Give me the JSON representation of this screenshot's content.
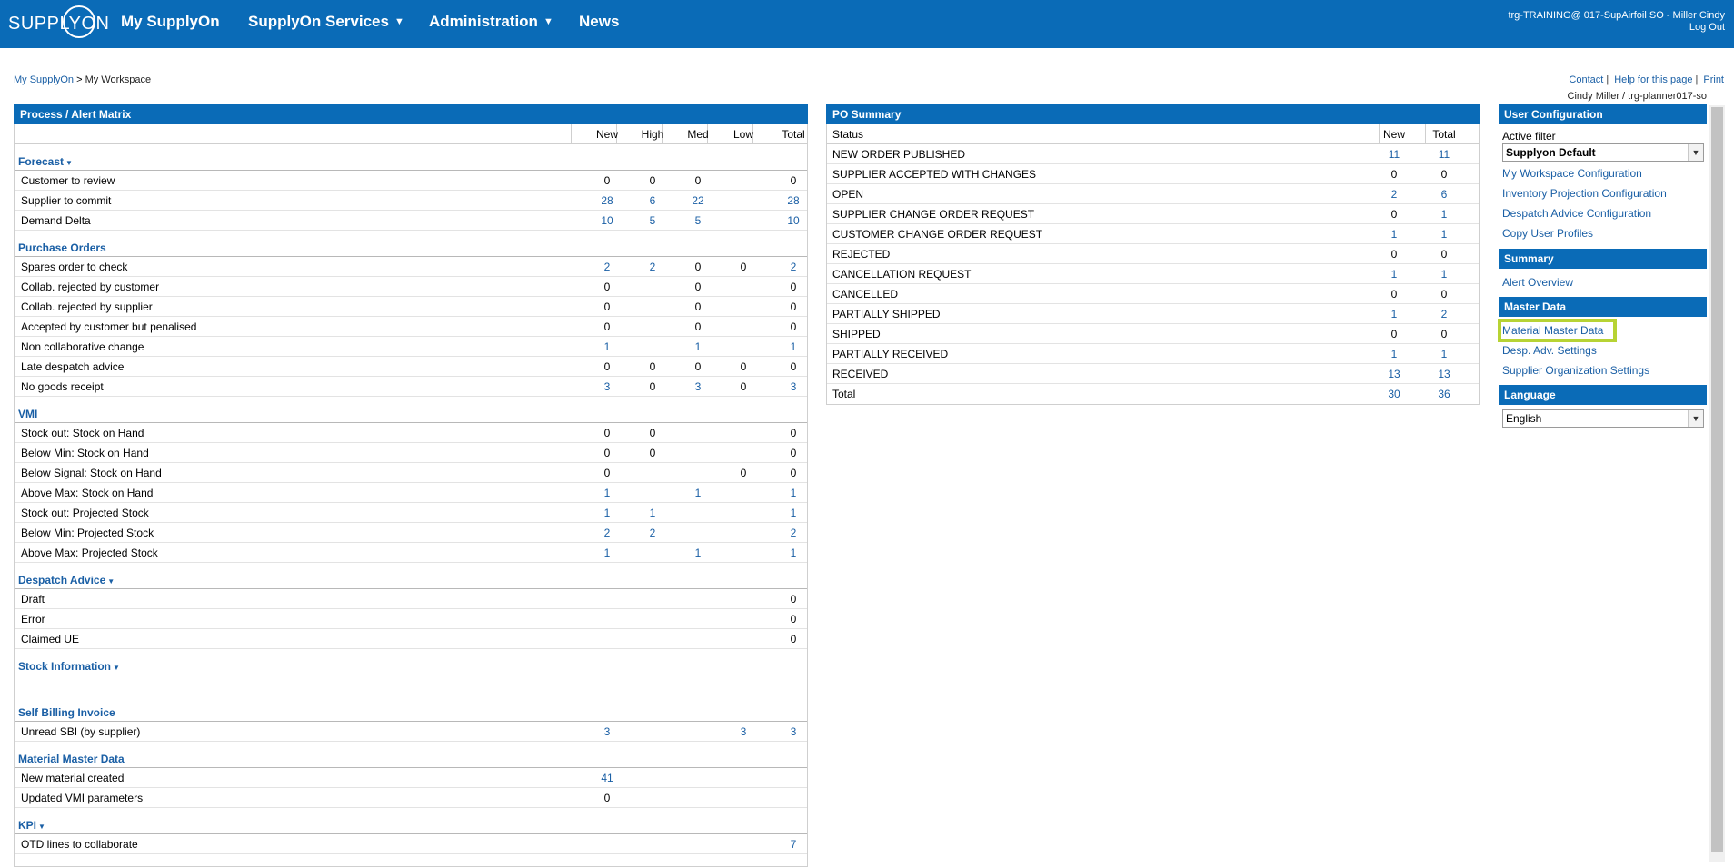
{
  "topbar": {
    "logo": "SUPPLYON",
    "nav": [
      {
        "label": "My SupplyOn",
        "caret": false
      },
      {
        "label": "SupplyOn Services",
        "caret": true
      },
      {
        "label": "Administration",
        "caret": true
      },
      {
        "label": "News",
        "caret": false
      }
    ],
    "user": "trg-TRAINING@ 017-SupAirfoil SO - Miller Cindy",
    "logout": "Log Out"
  },
  "breadcrumb": {
    "parent": "My SupplyOn",
    "sep": " > ",
    "current": "My Workspace"
  },
  "util": {
    "contact": "Contact",
    "help": "Help for this page",
    "print": "Print",
    "sep": "|"
  },
  "userline": "Cindy Miller / trg-planner017-so",
  "matrix": {
    "title": "Process / Alert Matrix",
    "columns": [
      "New",
      "High",
      "Med",
      "Low",
      "Total"
    ],
    "sections": [
      {
        "name": "Forecast",
        "dropdown": true,
        "rows": [
          {
            "label": "Customer to review",
            "v": [
              "0",
              "0",
              "0",
              "",
              "0"
            ]
          },
          {
            "label": "Supplier to commit",
            "v": [
              "28",
              "6",
              "22",
              "",
              "28"
            ]
          },
          {
            "label": "Demand Delta",
            "v": [
              "10",
              "5",
              "5",
              "",
              "10"
            ]
          }
        ]
      },
      {
        "name": "Purchase Orders",
        "dropdown": false,
        "rows": [
          {
            "label": "Spares order to check",
            "v": [
              "2",
              "2",
              "0",
              "0",
              "2"
            ]
          },
          {
            "label": "Collab. rejected by customer",
            "v": [
              "0",
              "",
              "0",
              "",
              "0"
            ]
          },
          {
            "label": "Collab. rejected by supplier",
            "v": [
              "0",
              "",
              "0",
              "",
              "0"
            ]
          },
          {
            "label": "Accepted by customer but penalised",
            "v": [
              "0",
              "",
              "0",
              "",
              "0"
            ]
          },
          {
            "label": "Non collaborative change",
            "v": [
              "1",
              "",
              "1",
              "",
              "1"
            ]
          },
          {
            "label": "Late despatch advice",
            "v": [
              "0",
              "0",
              "0",
              "0",
              "0"
            ]
          },
          {
            "label": "No goods receipt",
            "v": [
              "3",
              "0",
              "3",
              "0",
              "3"
            ]
          }
        ]
      },
      {
        "name": "VMI",
        "dropdown": false,
        "rows": [
          {
            "label": "Stock out: Stock on Hand",
            "v": [
              "0",
              "0",
              "",
              "",
              "0"
            ]
          },
          {
            "label": "Below Min: Stock on Hand",
            "v": [
              "0",
              "0",
              "",
              "",
              "0"
            ]
          },
          {
            "label": "Below Signal: Stock on Hand",
            "v": [
              "0",
              "",
              "",
              "0",
              "0"
            ]
          },
          {
            "label": "Above Max: Stock on Hand",
            "v": [
              "1",
              "",
              "1",
              "",
              "1"
            ]
          },
          {
            "label": "Stock out: Projected Stock",
            "v": [
              "1",
              "1",
              "",
              "",
              "1"
            ]
          },
          {
            "label": "Below Min: Projected Stock",
            "v": [
              "2",
              "2",
              "",
              "",
              "2"
            ]
          },
          {
            "label": "Above Max: Projected Stock",
            "v": [
              "1",
              "",
              "1",
              "",
              "1"
            ]
          }
        ]
      },
      {
        "name": "Despatch Advice",
        "dropdown": true,
        "rows": [
          {
            "label": "Draft",
            "v": [
              "",
              "",
              "",
              "",
              "0"
            ]
          },
          {
            "label": "Error",
            "v": [
              "",
              "",
              "",
              "",
              "0"
            ]
          },
          {
            "label": "Claimed UE",
            "v": [
              "",
              "",
              "",
              "",
              "0"
            ]
          }
        ]
      },
      {
        "name": "Stock Information",
        "dropdown": true,
        "rows": [
          {
            "label": "",
            "v": [
              "",
              "",
              "",
              "",
              ""
            ]
          }
        ]
      },
      {
        "name": "Self Billing Invoice",
        "dropdown": false,
        "rows": [
          {
            "label": "Unread SBI (by supplier)",
            "v": [
              "3",
              "",
              "",
              "3",
              "3"
            ]
          }
        ]
      },
      {
        "name": "Material Master Data",
        "dropdown": false,
        "rows": [
          {
            "label": "New material created",
            "v": [
              "41",
              "",
              "",
              "",
              ""
            ]
          },
          {
            "label": "Updated VMI parameters",
            "v": [
              "0",
              "",
              "",
              "",
              ""
            ]
          }
        ]
      },
      {
        "name": "KPI",
        "dropdown": true,
        "rows": [
          {
            "label": "OTD lines to collaborate",
            "v": [
              "",
              "",
              "",
              "",
              "7"
            ]
          }
        ]
      }
    ]
  },
  "po": {
    "title": "PO Summary",
    "columns": [
      "Status",
      "New",
      "Total"
    ],
    "rows": [
      {
        "label": "NEW ORDER PUBLISHED",
        "new": "11",
        "total": "11"
      },
      {
        "label": "SUPPLIER ACCEPTED WITH CHANGES",
        "new": "0",
        "total": "0"
      },
      {
        "label": "OPEN",
        "new": "2",
        "total": "6"
      },
      {
        "label": "SUPPLIER CHANGE ORDER REQUEST",
        "new": "0",
        "total": "1"
      },
      {
        "label": "CUSTOMER CHANGE ORDER REQUEST",
        "new": "1",
        "total": "1"
      },
      {
        "label": "REJECTED",
        "new": "0",
        "total": "0"
      },
      {
        "label": "CANCELLATION REQUEST",
        "new": "1",
        "total": "1"
      },
      {
        "label": "CANCELLED",
        "new": "0",
        "total": "0"
      },
      {
        "label": "PARTIALLY SHIPPED",
        "new": "1",
        "total": "2"
      },
      {
        "label": "SHIPPED",
        "new": "0",
        "total": "0"
      },
      {
        "label": "PARTIALLY RECEIVED",
        "new": "1",
        "total": "1"
      },
      {
        "label": "RECEIVED",
        "new": "13",
        "total": "13"
      },
      {
        "label": "Total",
        "new": "30",
        "total": "36"
      }
    ]
  },
  "config": {
    "user_config": {
      "title": "User Configuration",
      "filter_label": "Active filter",
      "filter_value": "Supplyon Default",
      "links": [
        "My Workspace Configuration",
        "Inventory Projection Configuration",
        "Despatch Advice Configuration",
        "Copy User Profiles"
      ]
    },
    "summary": {
      "title": "Summary",
      "links": [
        "Alert Overview"
      ]
    },
    "master_data": {
      "title": "Master Data",
      "links": [
        "Material Master Data",
        "Desp. Adv. Settings",
        "Supplier Organization Settings"
      ],
      "highlighted": "Material Master Data",
      "highlight_color": "#b7d334"
    },
    "language": {
      "title": "Language",
      "value": "English"
    }
  },
  "colors": {
    "brand": "#0a6bb7",
    "link": "#1a5fa5"
  }
}
